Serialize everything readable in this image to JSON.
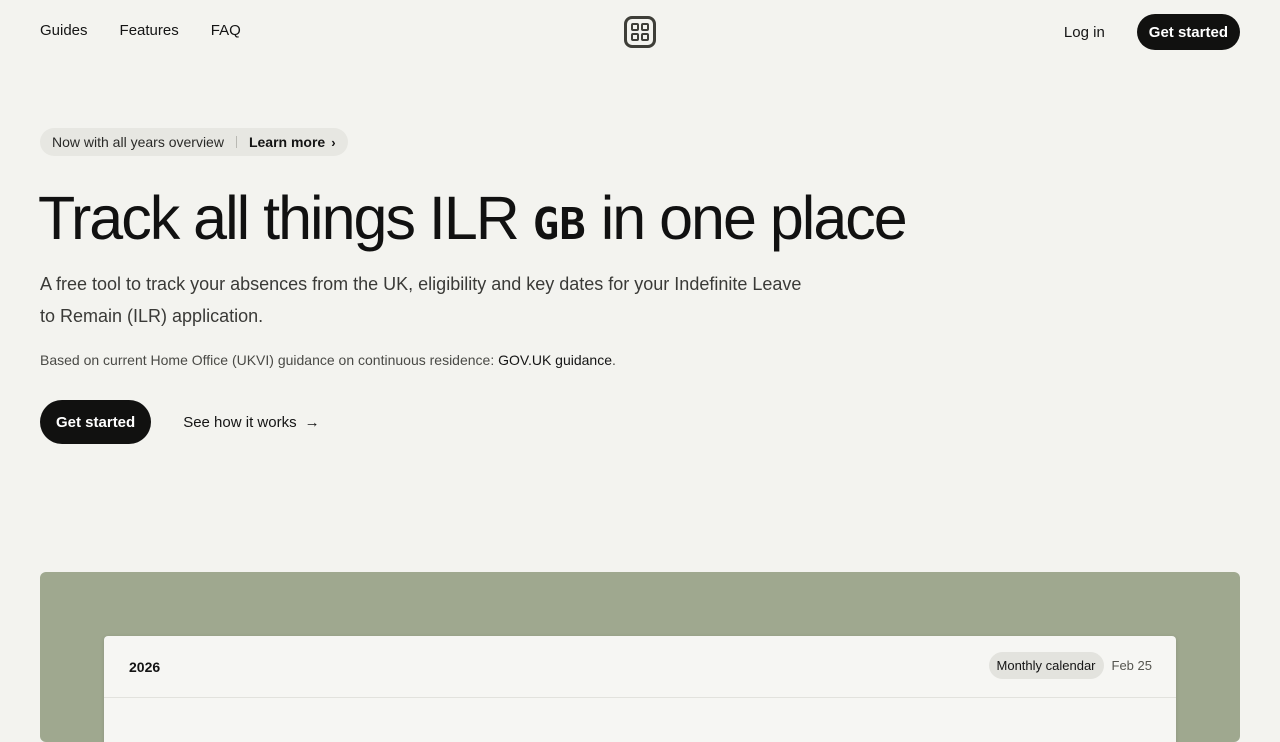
{
  "nav": {
    "links": [
      "Guides",
      "Features",
      "FAQ"
    ],
    "login": "Log in",
    "get_started": "Get started"
  },
  "announcement": {
    "text": "Now with all years overview",
    "link": "Learn more"
  },
  "hero": {
    "title_before": "Track all things ILR",
    "flag_text": "GB",
    "title_after": "in one place",
    "subtitle": "A free tool to track your absences from the UK, eligibility and key dates for your Indefinite Leave to Remain (ILR) application.",
    "guidance_text": "Based on current Home Office (UKVI) guidance on continuous residence: ",
    "guidance_link": "GOV.UK guidance",
    "guidance_suffix": ".",
    "primary_cta": "Get started",
    "secondary_cta": "See how it works"
  },
  "preview": {
    "year": "2026",
    "view_chip": "Monthly calendar",
    "date": "Feb 25"
  },
  "colors": {
    "background": "#f3f3ef",
    "button": "#111110",
    "showcase": "#9fa88f"
  }
}
